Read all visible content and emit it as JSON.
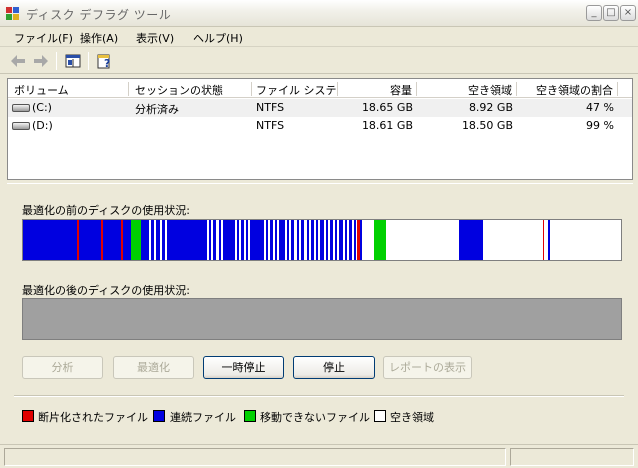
{
  "window": {
    "title": "ディスク デフラグ ツール",
    "min_symbol": "_",
    "max_symbol": "□",
    "close_symbol": "×"
  },
  "menu": [
    "ファイル(F)",
    "操作(A)",
    "表示(V)",
    "ヘルプ(H)"
  ],
  "columns": [
    "ボリューム",
    "セッションの状態",
    "ファイル システム",
    "容量",
    "空き領域",
    "空き領域の割合"
  ],
  "volumes": [
    {
      "volume": "(C:)",
      "status": "分析済み",
      "fs": "NTFS",
      "capacity": "18.65 GB",
      "free": "8.92 GB",
      "free_pct": "47 %"
    },
    {
      "volume": "(D:)",
      "status": "",
      "fs": "NTFS",
      "capacity": "18.61 GB",
      "free": "18.50 GB",
      "free_pct": "99 %"
    }
  ],
  "before_label": "最適化の前のディスクの使用状況:",
  "after_label": "最適化の後のディスクの使用状況:",
  "buttons": {
    "analyze": "分析",
    "defrag": "最適化",
    "pause": "一時停止",
    "stop": "停止",
    "report": "レポートの表示"
  },
  "legend": [
    {
      "label": "断片化されたファイル",
      "color": "#e00000"
    },
    {
      "label": "連続ファイル",
      "color": "#0000e0"
    },
    {
      "label": "移動できないファイル",
      "color": "#00d000"
    },
    {
      "label": "空き領域",
      "color": "#ffffff"
    }
  ],
  "colors": {
    "fragmented": "#e00000",
    "contiguous": "#0000e0",
    "unmovable": "#00d000",
    "free": "#ffffff",
    "after_bar": "#a0a0a0"
  }
}
